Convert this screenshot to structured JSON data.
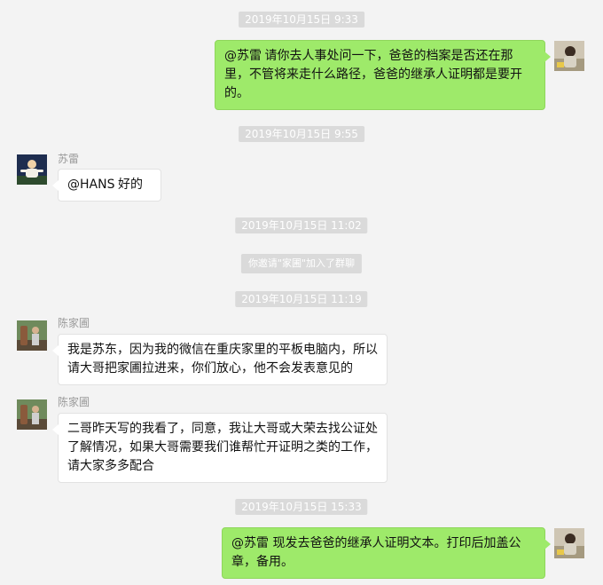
{
  "timestamps": [
    "2019年10月15日 9:33",
    "2019年10月15日 9:55",
    "2019年10月15日 11:02",
    "2019年10月15日 11:19",
    "2019年10月15日 15:33"
  ],
  "system_notice": "你邀请\"家圃\"加入了群聊",
  "messages": [
    {
      "side": "right",
      "text": "@苏雷 请你去人事处问一下，爸爸的档案是否还在那里，不管将来走什么路径，爸爸的继承人证明都是要开的。"
    },
    {
      "side": "left",
      "sender": "苏雷",
      "text": "@HANS 好的"
    },
    {
      "side": "left",
      "sender": "陈家圃",
      "text": "我是苏东，因为我的微信在重庆家里的平板电脑内，所以请大哥把家圃拉进来，你们放心，他不会发表意见的"
    },
    {
      "side": "left",
      "sender": "陈家圃",
      "text": "二哥昨天写的我看了，同意，我让大哥或大荣去找公证处了解情况，如果大哥需要我们谁帮忙开证明之类的工作，请大家多多配合"
    },
    {
      "side": "right",
      "text": "@苏雷  现发去爸爸的继承人证明文本。打印后加盖公章，备用。"
    }
  ]
}
